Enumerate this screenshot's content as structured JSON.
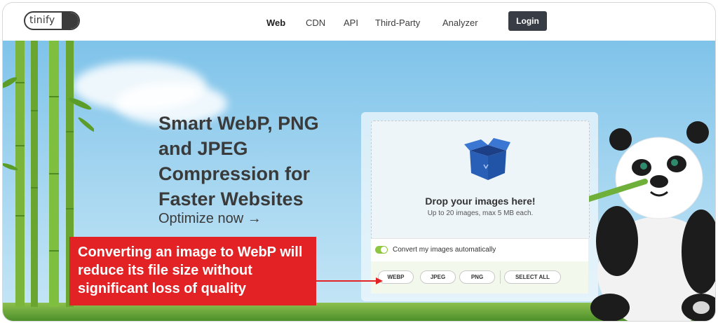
{
  "nav": {
    "logo": "tinify",
    "links": [
      "Web",
      "CDN",
      "API",
      "Third-Party",
      "Analyzer"
    ],
    "login": "Login"
  },
  "hero": {
    "headline": "Smart WebP, PNG and JPEG Compression for Faster Websites",
    "optimize": "Optimize now →"
  },
  "upload": {
    "title": "Drop your images here!",
    "subtitle": "Up to 20 images, max 5 MB each.",
    "convert_label": "Convert my images automatically",
    "formats": [
      "WEBP",
      "JPEG",
      "PNG"
    ],
    "select_all": "SELECT ALL"
  },
  "callout": {
    "text": "Converting an image to WebP will reduce its file size without significant loss of quality"
  },
  "colors": {
    "accent_red": "#e32226",
    "toggle_green": "#8ec63f",
    "login_bg": "#373c45"
  }
}
